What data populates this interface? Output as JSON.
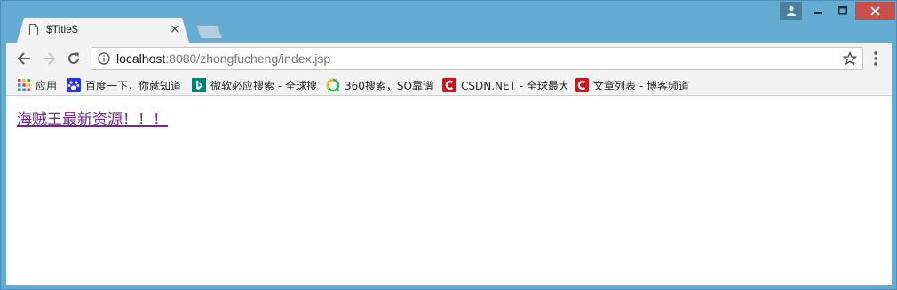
{
  "tab": {
    "title": "$Title$",
    "close_glyph": "×"
  },
  "window_controls": {
    "minimize": "—",
    "maximize": "☐",
    "close": "✕"
  },
  "toolbar": {
    "url_host": "localhost",
    "url_rest": ":8080/zhongfucheng/index.jsp"
  },
  "bookmarks": [
    {
      "label": "应用",
      "icon": "apps-grid-icon"
    },
    {
      "label": "百度一下，你就知道",
      "icon": "baidu-paw-icon"
    },
    {
      "label": "微软必应搜索 - 全球搜",
      "icon": "bing-icon"
    },
    {
      "label": "360搜索，SO靠谱",
      "icon": "so360-icon"
    },
    {
      "label": "CSDN.NET - 全球最大",
      "icon": "csdn-icon"
    },
    {
      "label": "文章列表 - 博客频道",
      "icon": "csdn-icon"
    }
  ],
  "content": {
    "link_text": "海贼王最新资源！！！"
  },
  "colors": {
    "link": "#6e2a8d",
    "titlebar": "#65acd3",
    "close_button": "#c9504a"
  }
}
